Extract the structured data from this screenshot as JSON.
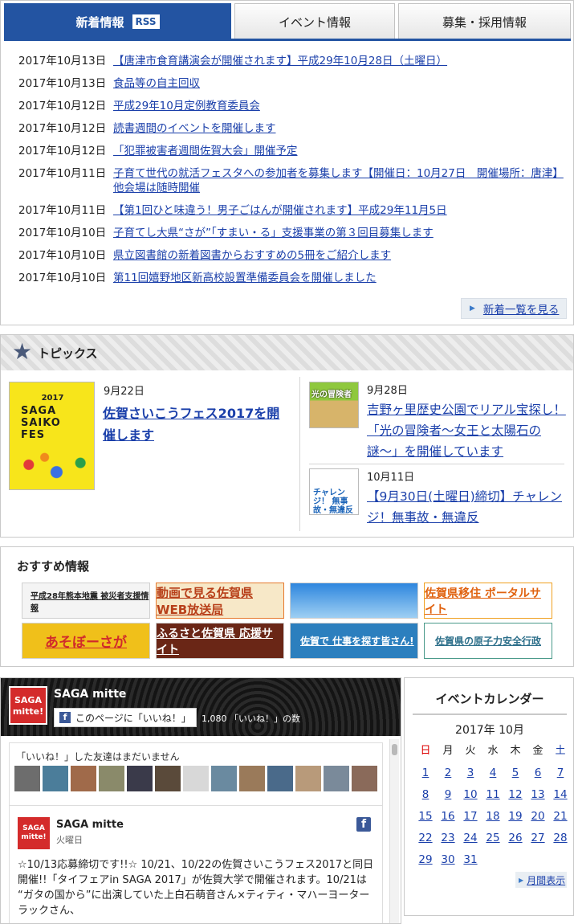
{
  "news": {
    "tabs": [
      {
        "label": "新着情報",
        "rss": "RSS"
      },
      {
        "label": "イベント情報"
      },
      {
        "label": "募集・採用情報"
      }
    ],
    "items": [
      {
        "date": "2017年10月13日",
        "title": "【唐津市食育講演会が開催されます】平成29年10月28日（土曜日）"
      },
      {
        "date": "2017年10月13日",
        "title": "食品等の自主回収"
      },
      {
        "date": "2017年10月12日",
        "title": "平成29年10月定例教育委員会"
      },
      {
        "date": "2017年10月12日",
        "title": "読書週間のイベントを開催します"
      },
      {
        "date": "2017年10月12日",
        "title": "「犯罪被害者週間佐賀大会」開催予定"
      },
      {
        "date": "2017年10月11日",
        "title": "子育て世代の就活フェスタへの参加者を募集します【開催日：10月27日　開催場所：唐津】 他会場は随時開催"
      },
      {
        "date": "2017年10月11日",
        "title": "【第1回ひと味違う！男子ごはんが開催されます】平成29年11月5日"
      },
      {
        "date": "2017年10月10日",
        "title": "子育てし大県“さが”「すまい・る」支援事業の第３回目募集します"
      },
      {
        "date": "2017年10月10日",
        "title": "県立図書館の新着図書からおすすめの5冊をご紹介します"
      },
      {
        "date": "2017年10月10日",
        "title": "第11回嬉野地区新高校設置準備委員会を開催しました"
      }
    ],
    "more_label": "新着一覧を見る"
  },
  "topics": {
    "title": "トピックス",
    "main": {
      "date": "9月22日",
      "title": "佐賀さいこうフェス2017を開催します",
      "thumb_top": "2017",
      "thumb_text": "SAGA SAIKO FES"
    },
    "sub": [
      {
        "date": "9月28日",
        "title": "吉野ヶ里歴史公園でリアル宝探し！「光の冒険者〜女王と太陽石の謎〜」を開催しています",
        "thumb_text": "光の冒険者"
      },
      {
        "date": "10月11日",
        "title": "【9月30日(土曜日)締切】チャレンジ！無事故・無違反",
        "thumb_text": "チャレンジ！ 無事故・無違反"
      }
    ]
  },
  "recommend": {
    "title": "おすすめ情報",
    "banners": [
      "平成28年熊本地震 被災者支援情報",
      "動画で見る佐賀県 WEB放送局",
      "",
      "佐賀県移住 ポータルサイト",
      "あそぼーさが",
      "ふるさと佐賀県 応援サイト",
      "佐賀で 仕事を探す皆さん!",
      "佐賀県の原子力安全行政"
    ]
  },
  "facebook": {
    "page_name": "SAGA mitte",
    "logo_text": "SAGA mitte!",
    "like_label": "このページに「いいね！」",
    "like_count": "1,080 「いいね！」の数",
    "friends_text": "「いいね！」した友達はまだいません",
    "post": {
      "author": "SAGA mitte",
      "day": "火曜日",
      "body": "☆10/13応募締切です!!☆ 10/21、10/22の佐賀さいこうフェス2017と同日開催!!「タイフェアin SAGA 2017」が佐賀大学で開催されます。10/21は “ガタの国から”に出演していた上白石萌音さん×ティティ・マハーヨーターラックさん、"
    }
  },
  "calendar": {
    "title": "イベントカレンダー",
    "month": "2017年 10月",
    "weekdays": [
      "日",
      "月",
      "火",
      "水",
      "木",
      "金",
      "土"
    ],
    "weeks": [
      [
        "1",
        "2",
        "3",
        "4",
        "5",
        "6",
        "7"
      ],
      [
        "8",
        "9",
        "10",
        "11",
        "12",
        "13",
        "14"
      ],
      [
        "15",
        "16",
        "17",
        "18",
        "19",
        "20",
        "21"
      ],
      [
        "22",
        "23",
        "24",
        "25",
        "26",
        "27",
        "28"
      ],
      [
        "29",
        "30",
        "31",
        "",
        "",
        "",
        ""
      ]
    ],
    "more_label": "月間表示"
  },
  "colors": {
    "accent": "#2354a2",
    "link": "#1a3faa",
    "sunday": "#dd0000"
  }
}
